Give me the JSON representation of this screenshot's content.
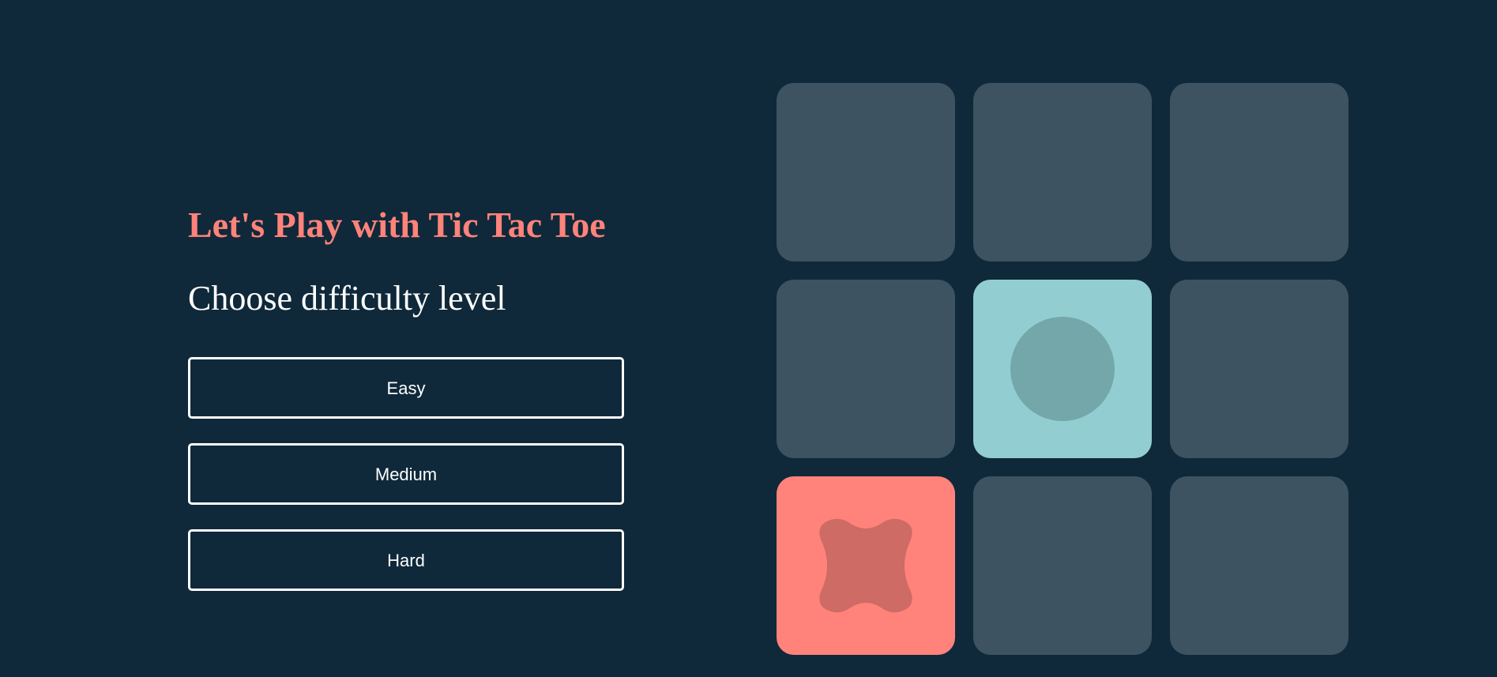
{
  "game": {
    "title": "Let's Play with Tic Tac Toe",
    "subtitle": "Choose difficulty level",
    "levels": [
      {
        "label": "Easy"
      },
      {
        "label": "Medium"
      },
      {
        "label": "Hard"
      }
    ]
  },
  "board": {
    "cells": [
      {
        "mark": ""
      },
      {
        "mark": ""
      },
      {
        "mark": ""
      },
      {
        "mark": ""
      },
      {
        "mark": "O"
      },
      {
        "mark": ""
      },
      {
        "mark": "X"
      },
      {
        "mark": ""
      },
      {
        "mark": ""
      }
    ]
  },
  "colors": {
    "background": "#0f293a",
    "title": "#ff837a",
    "cell_empty": "#3d5361",
    "cell_o": "#92cdd1",
    "mark_o": "#74a7aa",
    "cell_x": "#ff837a",
    "mark_x": "#cd6b64"
  }
}
